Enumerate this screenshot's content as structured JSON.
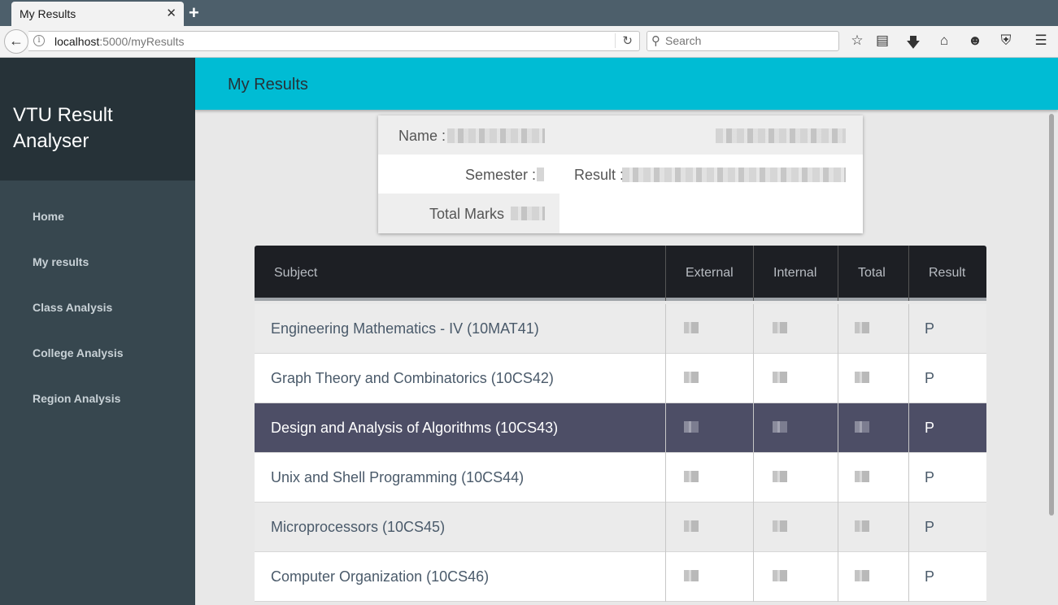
{
  "browser": {
    "tab_title": "My Results",
    "tab_close": "✕",
    "new_tab": "+",
    "url_host": "localhost",
    "url_path": ":5000/myResults",
    "search_placeholder": "Search",
    "icons": [
      "back-arrow-icon",
      "info-icon",
      "reload-icon",
      "search-icon",
      "bookmark-star-icon",
      "reading-list-icon",
      "download-icon",
      "home-icon",
      "chat-icon",
      "pocket-icon",
      "menu-icon"
    ]
  },
  "sidebar": {
    "brand": "VTU Result Analyser",
    "items": [
      {
        "label": "Home"
      },
      {
        "label": "My results"
      },
      {
        "label": "Class Analysis"
      },
      {
        "label": "College Analysis"
      },
      {
        "label": "Region Analysis"
      }
    ]
  },
  "header": {
    "title": "My Results"
  },
  "card": {
    "name_label": "Name :",
    "semester_label": "Semester :",
    "result_label": "Result :",
    "total_label": "Total Marks"
  },
  "table": {
    "columns": [
      "Subject",
      "External",
      "Internal",
      "Total",
      "Result"
    ],
    "rows": [
      {
        "subject": "Engineering Mathematics - IV (10MAT41)",
        "result": "P"
      },
      {
        "subject": "Graph Theory and Combinatorics (10CS42)",
        "result": "P"
      },
      {
        "subject": "Design and Analysis of Algorithms (10CS43)",
        "result": "P"
      },
      {
        "subject": "Unix and Shell Programming (10CS44)",
        "result": "P"
      },
      {
        "subject": "Microprocessors (10CS45)",
        "result": "P"
      },
      {
        "subject": "Computer Organization (10CS46)",
        "result": "P"
      }
    ]
  },
  "colors": {
    "sidebar": "#37474f",
    "brand_bg": "#263238",
    "header": "#00bcd4",
    "table_head": "#1d1f24",
    "active_row": "#4d4e66"
  }
}
